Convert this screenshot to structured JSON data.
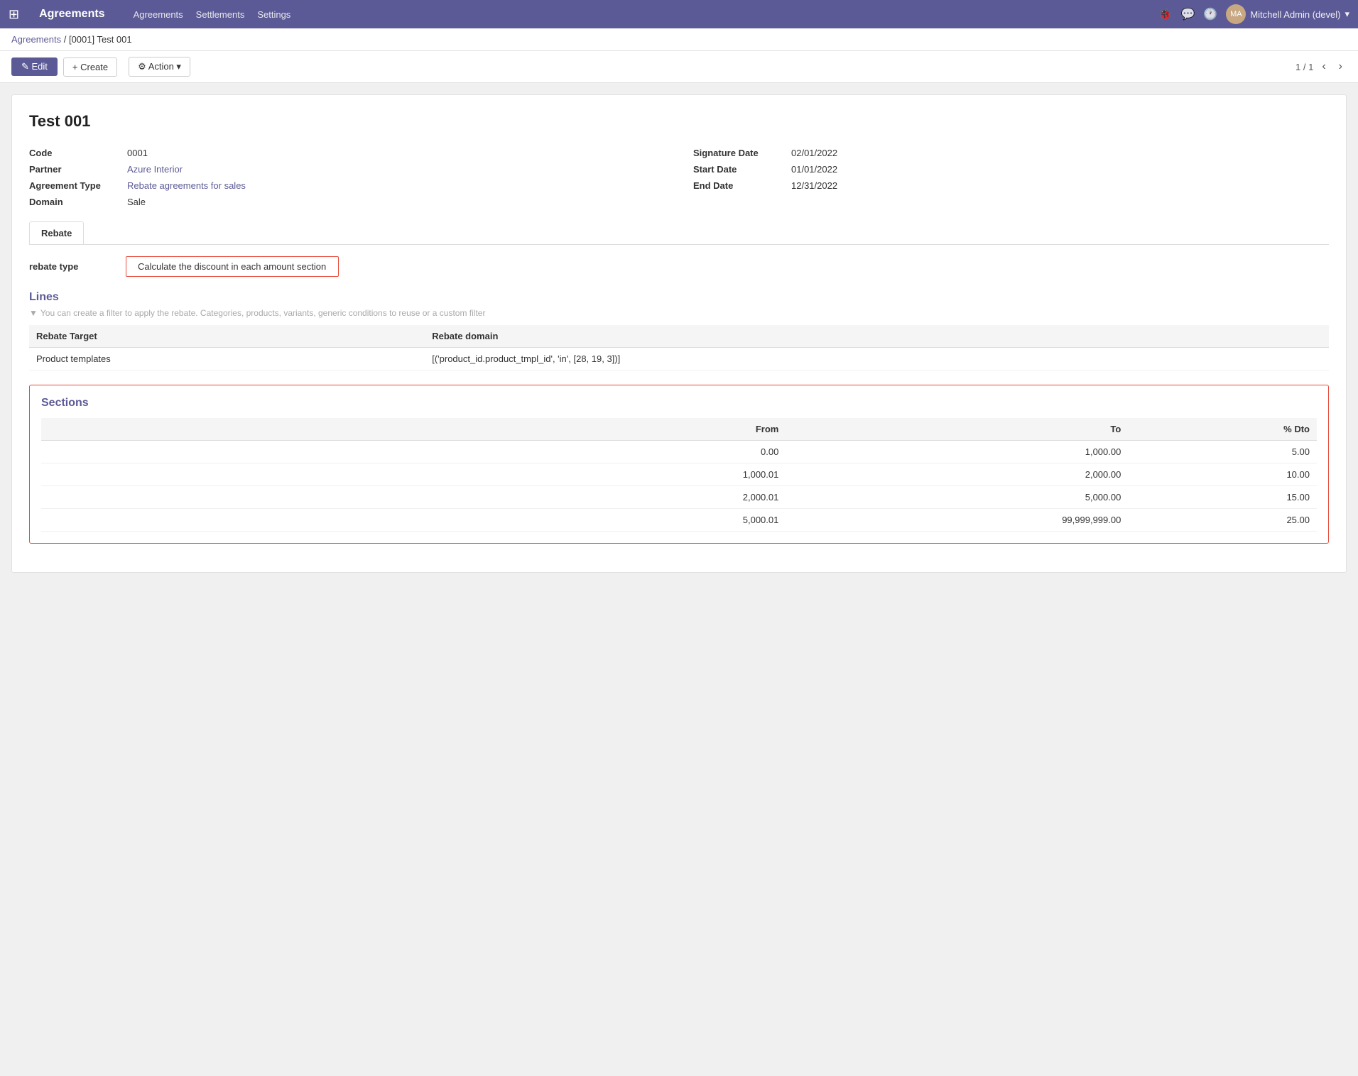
{
  "topnav": {
    "app_name": "Agreements",
    "menu_items": [
      "Agreements",
      "Settlements",
      "Settings"
    ],
    "user_name": "Mitchell Admin (devel)",
    "user_avatar": "MA"
  },
  "breadcrumb": {
    "parent": "Agreements",
    "current": "[0001] Test 001"
  },
  "toolbar": {
    "edit_label": "✎ Edit",
    "create_label": "+ Create",
    "action_label": "⚙ Action ▾",
    "pagination": "1 / 1"
  },
  "record": {
    "title": "Test 001",
    "code_label": "Code",
    "code_value": "0001",
    "partner_label": "Partner",
    "partner_value": "Azure Interior",
    "agreement_type_label": "Agreement Type",
    "agreement_type_value": "Rebate agreements for sales",
    "domain_label": "Domain",
    "domain_value": "Sale",
    "signature_date_label": "Signature Date",
    "signature_date_value": "02/01/2022",
    "start_date_label": "Start Date",
    "start_date_value": "01/01/2022",
    "end_date_label": "End Date",
    "end_date_value": "12/31/2022"
  },
  "tabs": [
    {
      "label": "Rebate",
      "active": true
    }
  ],
  "rebate": {
    "type_label": "rebate type",
    "type_value": "Calculate the discount in each amount section"
  },
  "lines": {
    "section_title": "Lines",
    "filter_hint": "You can create a filter to apply the rebate. Categories, products, variants, generic conditions to reuse or a custom filter",
    "columns": [
      "Rebate Target",
      "Rebate domain"
    ],
    "rows": [
      {
        "rebate_target": "Product templates",
        "rebate_domain": "[('product_id.product_tmpl_id', 'in', [28, 19, 3])]"
      }
    ]
  },
  "sections": {
    "title": "Sections",
    "columns": [
      "",
      "From",
      "To",
      "% Dto"
    ],
    "rows": [
      {
        "from": "0.00",
        "to": "1,000.00",
        "dto": "5.00"
      },
      {
        "from": "1,000.01",
        "to": "2,000.00",
        "dto": "10.00"
      },
      {
        "from": "2,000.01",
        "to": "5,000.00",
        "dto": "15.00"
      },
      {
        "from": "5,000.01",
        "to": "99,999,999.00",
        "dto": "25.00"
      }
    ]
  }
}
